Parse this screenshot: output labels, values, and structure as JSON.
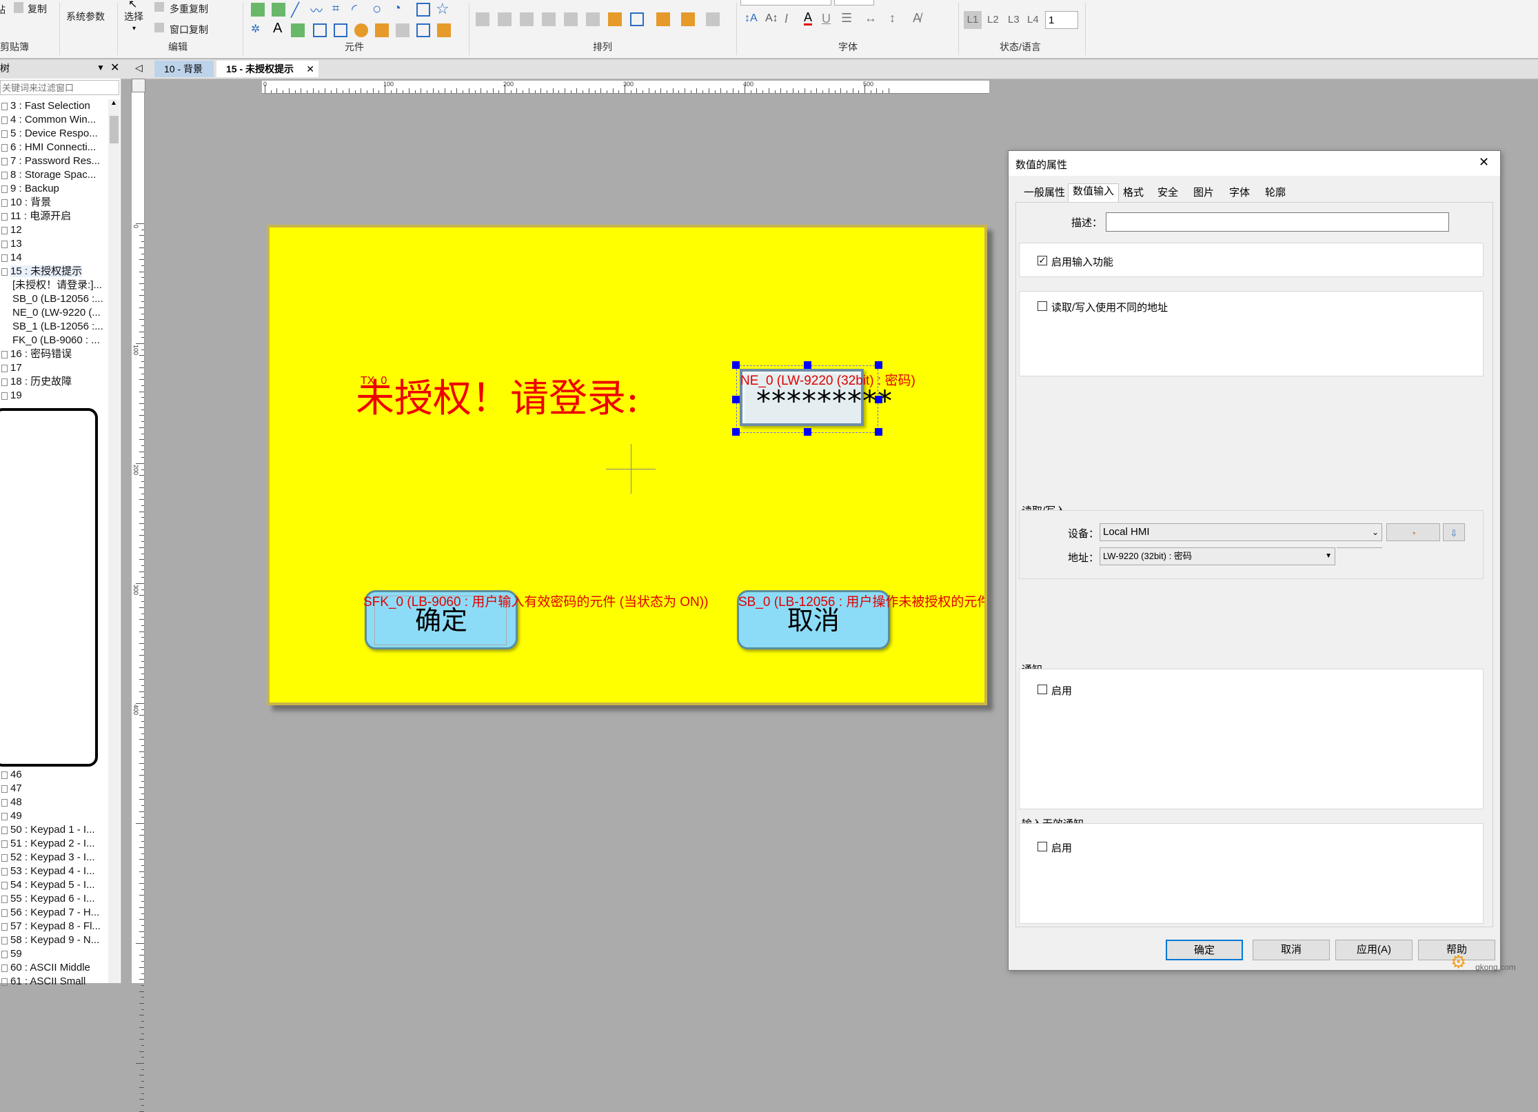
{
  "ribbon": {
    "copy": "复制",
    "system_params": "系统参数",
    "select": "选择",
    "multi_copy": "多重复制",
    "window_copy": "窗口复制",
    "groups": {
      "clipboard": "剪贴簿",
      "edit": "编辑",
      "elements": "元件",
      "arrange": "排列",
      "font": "字体",
      "state_lang": "状态/语言"
    },
    "levels": [
      "L1",
      "L2",
      "L3",
      "L4"
    ],
    "level_value": "1"
  },
  "tabs": [
    {
      "label": "10 - 背景"
    },
    {
      "label": "15 - 未授权提示"
    }
  ],
  "left_panel": {
    "filter_placeholder": "关键词来过滤窗口",
    "items": [
      "3 : Fast Selection",
      "4 : Common Win...",
      "5 : Device Respo...",
      "6 : HMI Connecti...",
      "7 : Password Res...",
      "8 : Storage Spac...",
      "9 : Backup",
      "10 : 背景",
      "11 : 电源开启",
      "12",
      "13",
      "14",
      "15 : 未授权提示"
    ],
    "children": [
      "[未授权！请登录:]...",
      "SB_0 (LB-12056 :...",
      "NE_0 (LW-9220 (...",
      "SB_1 (LB-12056 :...",
      "FK_0 (LB-9060 : ..."
    ],
    "items2": [
      "16 : 密码错误",
      "17",
      "18 : 历史故障",
      "19"
    ],
    "items3": [
      "46",
      "47",
      "48",
      "49",
      "50 : Keypad 1 - I...",
      "51 : Keypad 2 - I...",
      "52 : Keypad 3 - I...",
      "53 : Keypad 4 - I...",
      "54 : Keypad 5 - I...",
      "55 : Keypad 6 - I...",
      "56 : Keypad 7 - H...",
      "57 : Keypad 8 - Fl...",
      "58 : Keypad 9 - N...",
      "59",
      "60 : ASCII Middle",
      "61 : ASCII Small"
    ]
  },
  "ruler": {
    "h_labels": [
      "0",
      "100",
      "200",
      "300",
      "400",
      "500"
    ],
    "v_labels": [
      "0",
      "100",
      "200",
      "300",
      "400"
    ]
  },
  "screen": {
    "main_text": "未授权！请登录:",
    "tx_label": "TX_0",
    "ne_label": "NE_0 (LW-9220 (32bit) : 密码)",
    "ne_value": "*********",
    "overlay_label": "SFK_0 (LB-9060 : 用户输入有效密码的元件 (当状态为 ON))",
    "sb0_label": "SB_0 (LB-12056 : 用户操作未被授权的元件 (",
    "ok_button": "确定",
    "cancel_button": "取消"
  },
  "dialog": {
    "title": "数值的属性",
    "tabs": [
      "一般属性",
      "数值输入",
      "格式",
      "安全",
      "图片",
      "字体",
      "轮廓"
    ],
    "active_tab": "数值输入",
    "desc_label": "描述：",
    "desc_value": "",
    "enable_input": "启用输入功能",
    "diff_addr": "读取/写入使用不同的地址",
    "rw_group": "读取/写入",
    "device_label": "设备：",
    "device_value": "Local HMI",
    "address_label": "地址：",
    "address_value": "LW-9220 (32bit) : 密码",
    "notify_group": "通知",
    "notify_enable": "启用",
    "invalid_group": "输入无效通知",
    "invalid_enable": "启用",
    "buttons": {
      "ok": "确定",
      "cancel": "取消",
      "apply": "应用(A)",
      "help": "帮助"
    },
    "close": "✕"
  },
  "watermark": "gkong.com"
}
